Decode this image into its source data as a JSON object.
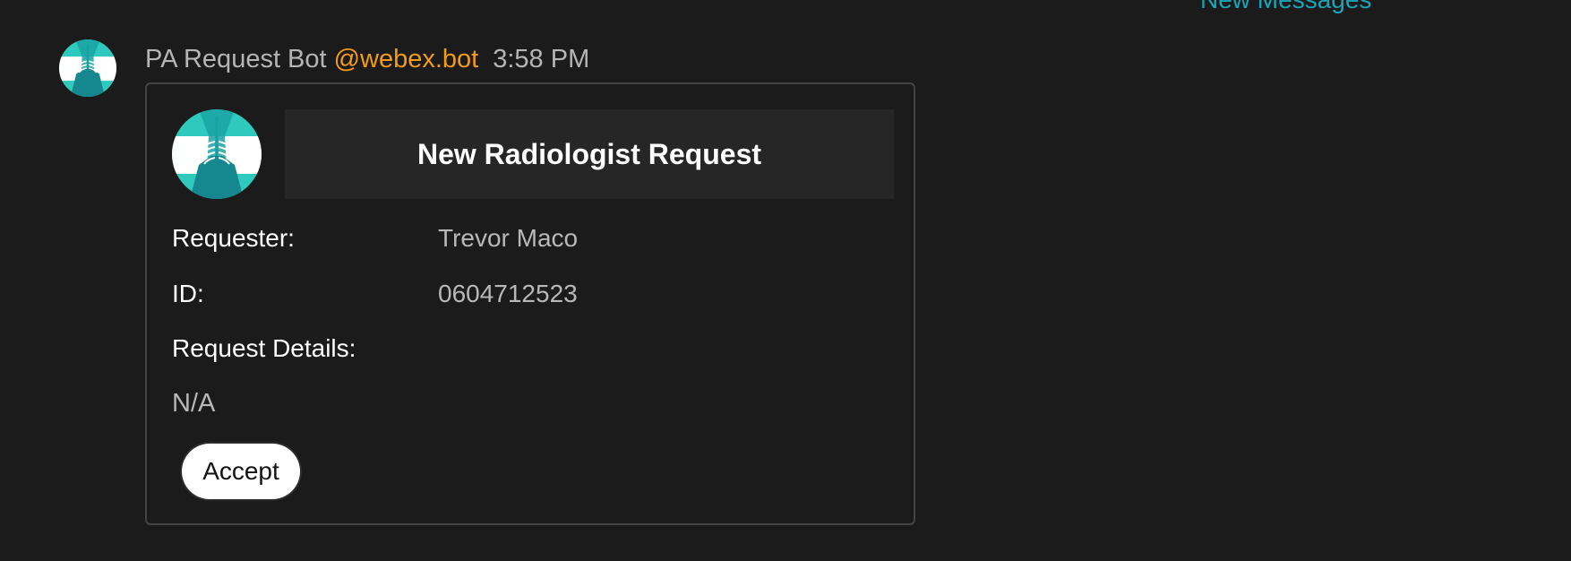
{
  "banner": {
    "new_messages_label": "New Messages"
  },
  "message": {
    "sender_name": "PA Request Bot",
    "sender_handle": "@webex.bot",
    "timestamp": "3:58 PM",
    "avatar_icon": "xray-chest-icon"
  },
  "card": {
    "title": "New Radiologist Request",
    "avatar_icon": "xray-chest-icon",
    "fields": [
      {
        "label": "Requester:",
        "value": "Trevor Maco"
      },
      {
        "label": "ID:",
        "value": "0604712523"
      }
    ],
    "details_label": "Request Details:",
    "details_value": "N/A",
    "accept_label": "Accept"
  },
  "colors": {
    "background": "#1b1b1b",
    "mention": "#f29b18",
    "link": "#1ba3b8",
    "avatar_teal": "#2bc4b8",
    "card_border": "#444444",
    "title_box": "#262626"
  }
}
